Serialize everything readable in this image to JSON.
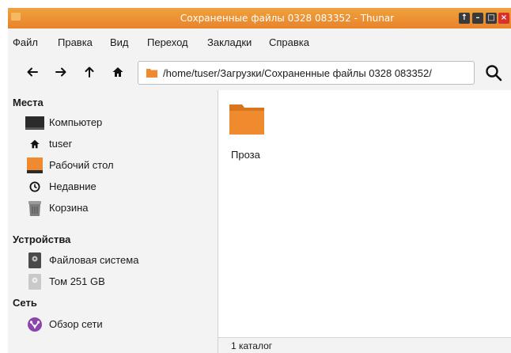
{
  "window": {
    "title": "Сохраненные файлы 0328 083352 - Thunar",
    "controls": {
      "up": "↑",
      "minimize": "–",
      "maximize": "□",
      "close": "×"
    }
  },
  "menu": [
    "Файл",
    "Правка",
    "Вид",
    "Переход",
    "Закладки",
    "Справка"
  ],
  "toolbar": {
    "back_icon": "back-arrow-icon",
    "forward_icon": "forward-arrow-icon",
    "up_icon": "up-arrow-icon",
    "home_icon": "home-icon",
    "path": "/home/tuser/Загрузки/Сохраненные файлы 0328 083352/",
    "search_icon": "search-icon"
  },
  "sidebar": {
    "places_heading": "Места",
    "places": [
      {
        "label": "Компьютер",
        "icon": "computer-icon"
      },
      {
        "label": "tuser",
        "icon": "home-icon"
      },
      {
        "label": "Рабочий стол",
        "icon": "desktop-icon"
      },
      {
        "label": "Недавние",
        "icon": "clock-icon"
      },
      {
        "label": "Корзина",
        "icon": "trash-icon"
      }
    ],
    "devices_heading": "Устройства",
    "devices": [
      {
        "label": "Файловая система",
        "icon": "drive-icon"
      },
      {
        "label": "Том 251 GB",
        "icon": "volume-icon"
      }
    ],
    "network_heading": "Сеть",
    "network": [
      {
        "label": "Обзор сети",
        "icon": "network-icon"
      }
    ]
  },
  "files": [
    {
      "name": "Проза",
      "icon": "folder-icon"
    }
  ],
  "status": "1 каталог",
  "colors": {
    "titlebar": "#e8832b",
    "folder": "#f08a2e",
    "accent_purple": "#8e44ad"
  }
}
